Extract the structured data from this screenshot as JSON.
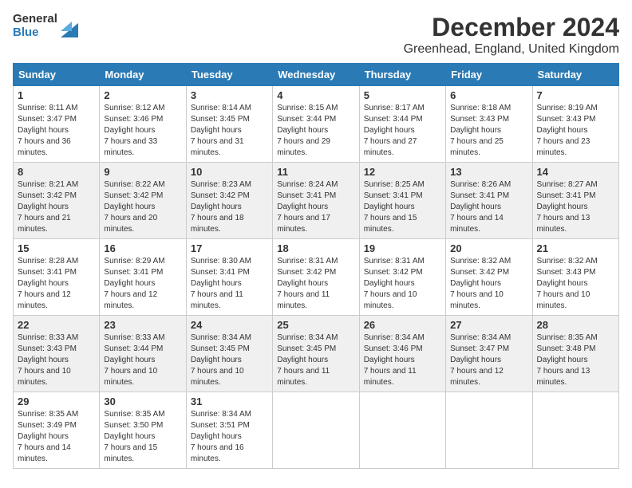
{
  "logo": {
    "general": "General",
    "blue": "Blue"
  },
  "title": "December 2024",
  "subtitle": "Greenhead, England, United Kingdom",
  "days_of_week": [
    "Sunday",
    "Monday",
    "Tuesday",
    "Wednesday",
    "Thursday",
    "Friday",
    "Saturday"
  ],
  "weeks": [
    [
      {
        "day": 1,
        "sunrise": "8:11 AM",
        "sunset": "3:47 PM",
        "daylight": "7 hours and 36 minutes."
      },
      {
        "day": 2,
        "sunrise": "8:12 AM",
        "sunset": "3:46 PM",
        "daylight": "7 hours and 33 minutes."
      },
      {
        "day": 3,
        "sunrise": "8:14 AM",
        "sunset": "3:45 PM",
        "daylight": "7 hours and 31 minutes."
      },
      {
        "day": 4,
        "sunrise": "8:15 AM",
        "sunset": "3:44 PM",
        "daylight": "7 hours and 29 minutes."
      },
      {
        "day": 5,
        "sunrise": "8:17 AM",
        "sunset": "3:44 PM",
        "daylight": "7 hours and 27 minutes."
      },
      {
        "day": 6,
        "sunrise": "8:18 AM",
        "sunset": "3:43 PM",
        "daylight": "7 hours and 25 minutes."
      },
      {
        "day": 7,
        "sunrise": "8:19 AM",
        "sunset": "3:43 PM",
        "daylight": "7 hours and 23 minutes."
      }
    ],
    [
      {
        "day": 8,
        "sunrise": "8:21 AM",
        "sunset": "3:42 PM",
        "daylight": "7 hours and 21 minutes."
      },
      {
        "day": 9,
        "sunrise": "8:22 AM",
        "sunset": "3:42 PM",
        "daylight": "7 hours and 20 minutes."
      },
      {
        "day": 10,
        "sunrise": "8:23 AM",
        "sunset": "3:42 PM",
        "daylight": "7 hours and 18 minutes."
      },
      {
        "day": 11,
        "sunrise": "8:24 AM",
        "sunset": "3:41 PM",
        "daylight": "7 hours and 17 minutes."
      },
      {
        "day": 12,
        "sunrise": "8:25 AM",
        "sunset": "3:41 PM",
        "daylight": "7 hours and 15 minutes."
      },
      {
        "day": 13,
        "sunrise": "8:26 AM",
        "sunset": "3:41 PM",
        "daylight": "7 hours and 14 minutes."
      },
      {
        "day": 14,
        "sunrise": "8:27 AM",
        "sunset": "3:41 PM",
        "daylight": "7 hours and 13 minutes."
      }
    ],
    [
      {
        "day": 15,
        "sunrise": "8:28 AM",
        "sunset": "3:41 PM",
        "daylight": "7 hours and 12 minutes."
      },
      {
        "day": 16,
        "sunrise": "8:29 AM",
        "sunset": "3:41 PM",
        "daylight": "7 hours and 12 minutes."
      },
      {
        "day": 17,
        "sunrise": "8:30 AM",
        "sunset": "3:41 PM",
        "daylight": "7 hours and 11 minutes."
      },
      {
        "day": 18,
        "sunrise": "8:31 AM",
        "sunset": "3:42 PM",
        "daylight": "7 hours and 11 minutes."
      },
      {
        "day": 19,
        "sunrise": "8:31 AM",
        "sunset": "3:42 PM",
        "daylight": "7 hours and 10 minutes."
      },
      {
        "day": 20,
        "sunrise": "8:32 AM",
        "sunset": "3:42 PM",
        "daylight": "7 hours and 10 minutes."
      },
      {
        "day": 21,
        "sunrise": "8:32 AM",
        "sunset": "3:43 PM",
        "daylight": "7 hours and 10 minutes."
      }
    ],
    [
      {
        "day": 22,
        "sunrise": "8:33 AM",
        "sunset": "3:43 PM",
        "daylight": "7 hours and 10 minutes."
      },
      {
        "day": 23,
        "sunrise": "8:33 AM",
        "sunset": "3:44 PM",
        "daylight": "7 hours and 10 minutes."
      },
      {
        "day": 24,
        "sunrise": "8:34 AM",
        "sunset": "3:45 PM",
        "daylight": "7 hours and 10 minutes."
      },
      {
        "day": 25,
        "sunrise": "8:34 AM",
        "sunset": "3:45 PM",
        "daylight": "7 hours and 11 minutes."
      },
      {
        "day": 26,
        "sunrise": "8:34 AM",
        "sunset": "3:46 PM",
        "daylight": "7 hours and 11 minutes."
      },
      {
        "day": 27,
        "sunrise": "8:34 AM",
        "sunset": "3:47 PM",
        "daylight": "7 hours and 12 minutes."
      },
      {
        "day": 28,
        "sunrise": "8:35 AM",
        "sunset": "3:48 PM",
        "daylight": "7 hours and 13 minutes."
      }
    ],
    [
      {
        "day": 29,
        "sunrise": "8:35 AM",
        "sunset": "3:49 PM",
        "daylight": "7 hours and 14 minutes."
      },
      {
        "day": 30,
        "sunrise": "8:35 AM",
        "sunset": "3:50 PM",
        "daylight": "7 hours and 15 minutes."
      },
      {
        "day": 31,
        "sunrise": "8:34 AM",
        "sunset": "3:51 PM",
        "daylight": "7 hours and 16 minutes."
      },
      null,
      null,
      null,
      null
    ]
  ],
  "label_sunrise": "Sunrise:",
  "label_sunset": "Sunset:",
  "label_daylight": "Daylight hours"
}
